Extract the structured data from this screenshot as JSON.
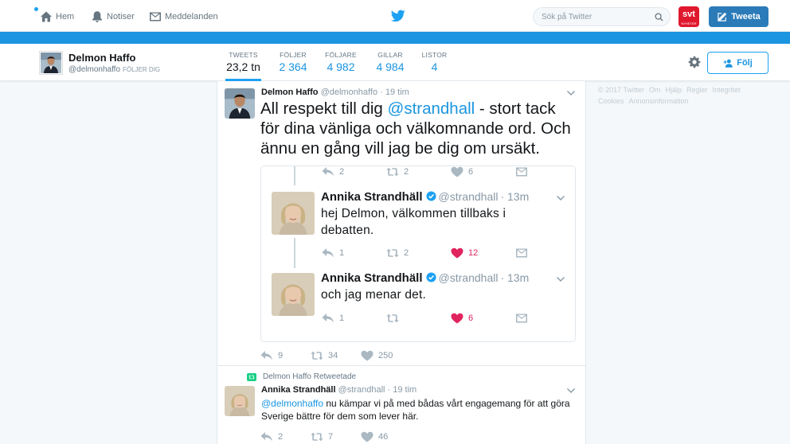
{
  "nav": {
    "home_label": "Hem",
    "notifications_label": "Notiser",
    "messages_label": "Meddelanden",
    "search_placeholder": "Sök på Twitter",
    "svt_logo": "svt",
    "svt_sub": "NYHETER",
    "tweet_button_label": "Tweeta"
  },
  "profile": {
    "name": "Delmon Haffo",
    "handle": "@delmonhaffo",
    "follows_you": "FÖLJER DIG",
    "stats": [
      {
        "label": "TWEETS",
        "value": "23,2 tn"
      },
      {
        "label": "FÖLJER",
        "value": "2 364"
      },
      {
        "label": "FÖLJARE",
        "value": "4 982"
      },
      {
        "label": "GILLAR",
        "value": "4 984"
      },
      {
        "label": "LISTOR",
        "value": "4"
      }
    ],
    "follow_button_label": "Följ"
  },
  "tweet1": {
    "author_name": "Delmon Haffo",
    "author_handle": "@delmonhaffo",
    "time": "· 19 tim",
    "text_before": "All respekt till dig ",
    "mention": "@strandhall",
    "text_after": " - stort tack för dina vänliga och välkomnande ord. Och ännu en gång vill jag be dig om ursäkt.",
    "context_actions": {
      "replies": "2",
      "retweets": "2",
      "likes": "6"
    },
    "quoted": [
      {
        "author_name": "Annika Strandhäll",
        "author_handle": "@strandhall",
        "time": "· 13m",
        "text": "hej Delmon, välkommen tillbaks i debatten.",
        "replies": "1",
        "retweets": "2",
        "likes": "12"
      },
      {
        "author_name": "Annika Strandhäll",
        "author_handle": "@strandhall",
        "time": "· 13m",
        "text": "och jag menar det.",
        "replies": "1",
        "retweets": "",
        "likes": "6"
      }
    ],
    "replies": "9",
    "retweets": "34",
    "likes": "250"
  },
  "tweet2": {
    "retweeted_by": "Delmon Haffo Retweetade",
    "author_name": "Annika Strandhäll",
    "author_handle": "@strandhall",
    "time": "· 19 tim",
    "mention": "@delmonhaffo",
    "text_after": " nu kämpar vi på med bådas vårt engagemang för att göra Sverige bättre för dem som lever här.",
    "replies": "2",
    "retweets": "7",
    "likes": "46"
  },
  "footer": {
    "links": [
      "© 2017 Twitter",
      "Om",
      "Hjälp",
      "Regler",
      "Integritet",
      "Cookies",
      "Annonsinformation"
    ]
  },
  "colors": {
    "accent": "#1da1f2",
    "brand_bar": "#1b95e0",
    "like": "#e0245e",
    "retweet": "#19cf86",
    "svt_red": "#e0182d"
  }
}
